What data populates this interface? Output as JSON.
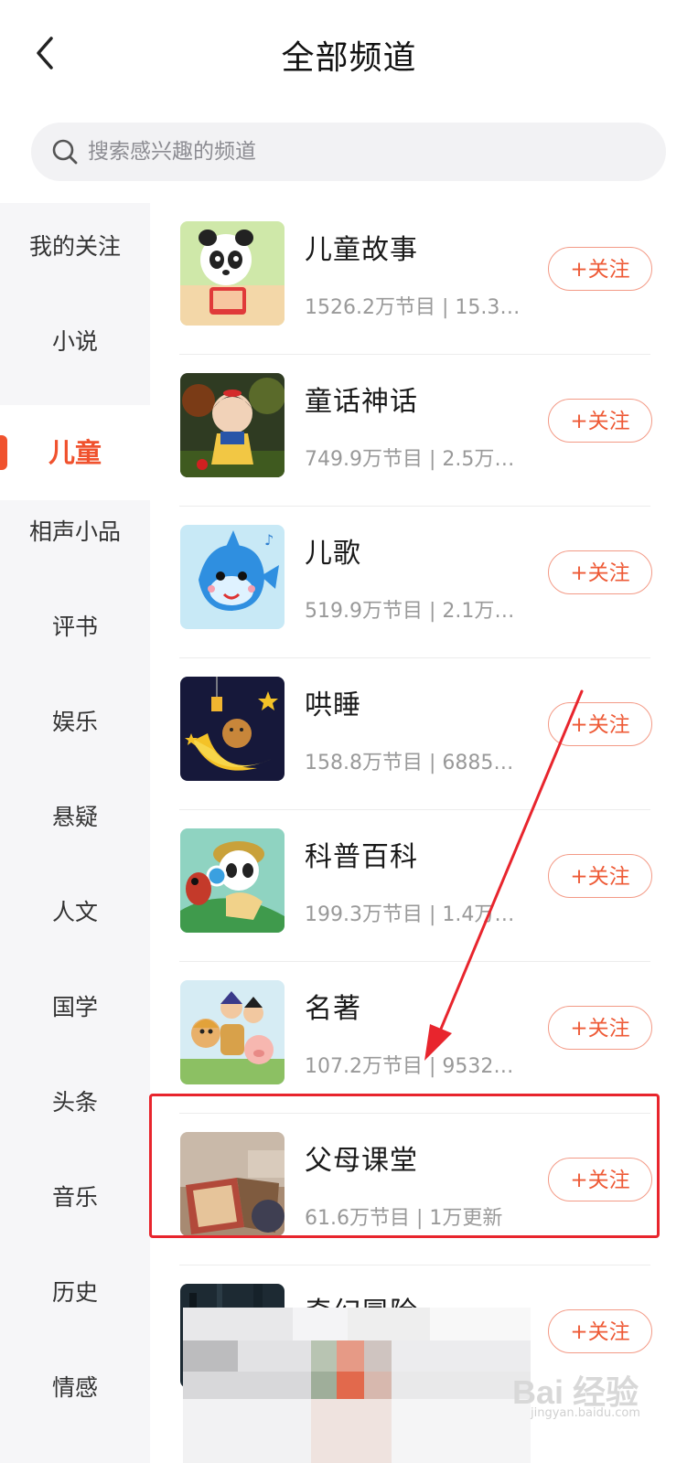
{
  "header": {
    "title": "全部频道",
    "back_icon": "chevron-left-icon"
  },
  "search": {
    "placeholder": "搜索感兴趣的频道",
    "icon": "search-icon"
  },
  "sidebar": {
    "active_index": 2,
    "items": [
      {
        "label": "我的关注"
      },
      {
        "label": "小说"
      },
      {
        "label": "儿童"
      },
      {
        "label": "相声小品"
      },
      {
        "label": "评书"
      },
      {
        "label": "娱乐"
      },
      {
        "label": "悬疑"
      },
      {
        "label": "人文"
      },
      {
        "label": "国学"
      },
      {
        "label": "头条"
      },
      {
        "label": "音乐"
      },
      {
        "label": "历史"
      },
      {
        "label": "情感"
      }
    ]
  },
  "channels": [
    {
      "name": "儿童故事",
      "meta": "1526.2万节目 | 15.3…",
      "follow_label": "+关注",
      "thumb": "panda-reading"
    },
    {
      "name": "童话神话",
      "meta": "749.9万节目 | 2.5万…",
      "follow_label": "+关注",
      "thumb": "snow-white"
    },
    {
      "name": "儿歌",
      "meta": "519.9万节目 | 2.1万…",
      "follow_label": "+关注",
      "thumb": "blue-fish"
    },
    {
      "name": "哄睡",
      "meta": "158.8万节目 | 6885…",
      "follow_label": "+关注",
      "thumb": "moon-bear"
    },
    {
      "name": "科普百科",
      "meta": "199.3万节目 | 1.4万…",
      "follow_label": "+关注",
      "thumb": "panda-explorer"
    },
    {
      "name": "名著",
      "meta": "107.2万节目 | 9532…",
      "follow_label": "+关注",
      "thumb": "journey-west"
    },
    {
      "name": "父母课堂",
      "meta": "61.6万节目 | 1万更新",
      "follow_label": "+关注",
      "thumb": "picture-book"
    },
    {
      "name": "奇幻冒险",
      "meta": "",
      "follow_label": "+关注",
      "thumb": "dark-forest"
    }
  ],
  "annotation": {
    "highlighted_channel": "父母课堂",
    "color": "#e8252d"
  },
  "watermark": {
    "logo": "Bai 经验",
    "url": "jingyan.baidu.com"
  },
  "colors": {
    "accent": "#f0522e",
    "sidebar_bg": "#f6f6f8",
    "meta_text": "#999999"
  }
}
